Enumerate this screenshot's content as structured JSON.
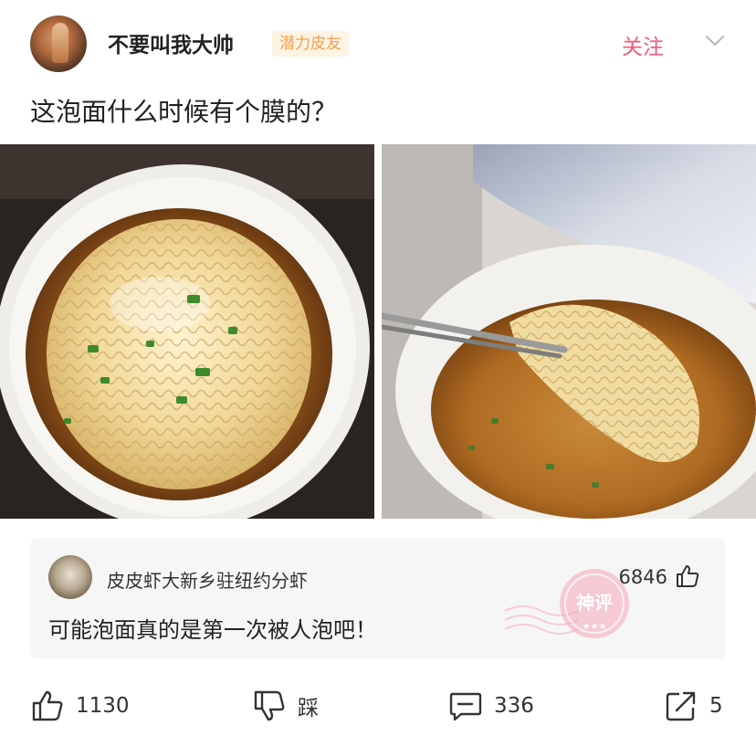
{
  "post": {
    "author": "不要叫我大帅",
    "badge": "潜力皮友",
    "follow_label": "关注",
    "text": "这泡面什么时候有个膜的？"
  },
  "hot_comment": {
    "author": "皮皮虾大新乡驻纽约分虾",
    "likes": "6846",
    "text": "可能泡面真的是第一次被人泡吧！",
    "stamp_text": "神评"
  },
  "actions": {
    "like_count": "1130",
    "dislike_label": "踩",
    "comment_count": "336",
    "share_count": "5"
  },
  "icons": {
    "like": "thumbs-up-icon",
    "dislike": "thumbs-down-icon",
    "comment": "comment-bubble-icon",
    "share": "share-arrow-icon",
    "more": "chevron-down-icon"
  },
  "colors": {
    "follow": "#f05a78",
    "badge_text": "#f5a04a",
    "badge_bg": "#fff3e3",
    "stamp": "#f28ba2"
  }
}
